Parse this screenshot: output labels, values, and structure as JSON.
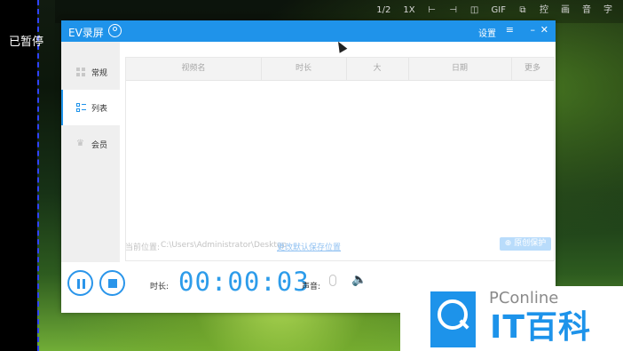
{
  "status": {
    "paused_text": "已暂停"
  },
  "toolbar": {
    "items": [
      "1/2",
      "1X",
      "⊢",
      "⊣",
      "◫",
      "GIF",
      "⧉",
      "控",
      "画",
      "音",
      "字"
    ]
  },
  "window": {
    "title": "EV录屏",
    "settings_label": "设置",
    "buttons": {
      "menu": "≡",
      "minimize": "–",
      "close": "✕"
    }
  },
  "sidebar": {
    "items": [
      {
        "label": "常规",
        "icon": "grid-icon"
      },
      {
        "label": "列表",
        "icon": "list-icon",
        "active": true
      },
      {
        "label": "会员",
        "icon": "crown-icon"
      }
    ]
  },
  "table": {
    "columns": [
      "视频名",
      "时长",
      "大",
      "日期",
      "更多"
    ],
    "rows": []
  },
  "path": {
    "label": "当前位置:",
    "value": "C:\\Users\\Administrator\\Desktop",
    "change_link": "更改默认保存位置"
  },
  "buttons": {
    "protect": "⊕ 原创保护"
  },
  "recorder": {
    "duration_label": "时长:",
    "timer": "00:00:03",
    "sound_label": "声音:"
  },
  "watermark": {
    "brand": "PConline",
    "product": "IT百科"
  },
  "colors": {
    "accent": "#1f93ea",
    "timer": "#2d9cea"
  }
}
